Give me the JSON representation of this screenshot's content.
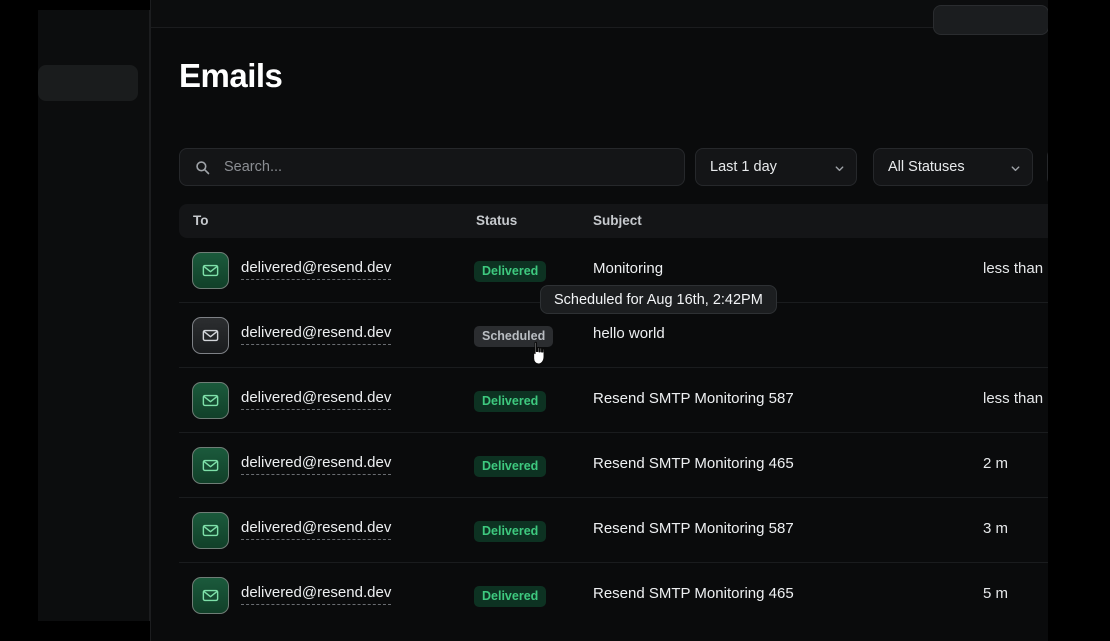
{
  "sidebar": {
    "selected_item_label": ""
  },
  "topbar": {
    "button_label": ""
  },
  "page": {
    "title": "Emails"
  },
  "search": {
    "value": "",
    "placeholder": "Search...",
    "icon": "search-icon"
  },
  "filters": {
    "date_range": {
      "label": "Last 1 day",
      "icon": "chevron-down-icon"
    },
    "status": {
      "label": "All Statuses",
      "icon": "chevron-down-icon"
    },
    "third": {
      "label": "",
      "icon": "chevron-down-icon"
    }
  },
  "table": {
    "columns": {
      "to": "To",
      "status": "Status",
      "subject": "Subject",
      "when": ""
    },
    "rows": [
      {
        "icon": "envelope-icon",
        "to": "delivered@resend.dev",
        "status": "Delivered",
        "status_kind": "delivered",
        "subject": "Monitoring",
        "when": "less than"
      },
      {
        "icon": "envelope-icon",
        "to": "delivered@resend.dev",
        "status": "Scheduled",
        "status_kind": "scheduled",
        "subject": "hello world",
        "when": ""
      },
      {
        "icon": "envelope-icon",
        "to": "delivered@resend.dev",
        "status": "Delivered",
        "status_kind": "delivered",
        "subject": "Resend SMTP Monitoring 587",
        "when": "less than"
      },
      {
        "icon": "envelope-icon",
        "to": "delivered@resend.dev",
        "status": "Delivered",
        "status_kind": "delivered",
        "subject": "Resend SMTP Monitoring 465",
        "when": "2 m"
      },
      {
        "icon": "envelope-icon",
        "to": "delivered@resend.dev",
        "status": "Delivered",
        "status_kind": "delivered",
        "subject": "Resend SMTP Monitoring 587",
        "when": "3 m"
      },
      {
        "icon": "envelope-icon",
        "to": "delivered@resend.dev",
        "status": "Delivered",
        "status_kind": "delivered",
        "subject": "Resend SMTP Monitoring 465",
        "when": "5 m"
      }
    ]
  },
  "tooltip": {
    "text": "Scheduled for Aug 16th, 2:42PM"
  },
  "cursor": {
    "icon": "pointer-hand-cursor"
  },
  "colors": {
    "background": "#000000",
    "panel": "#0a0b0c",
    "control": "#141517",
    "border": "#26282b",
    "delivered_badge_bg": "#0d3222",
    "delivered_badge_text": "#3ec97f",
    "scheduled_badge_bg": "#2b2d30",
    "scheduled_badge_text": "#b9bdc2",
    "text_primary": "#eef0f2"
  }
}
